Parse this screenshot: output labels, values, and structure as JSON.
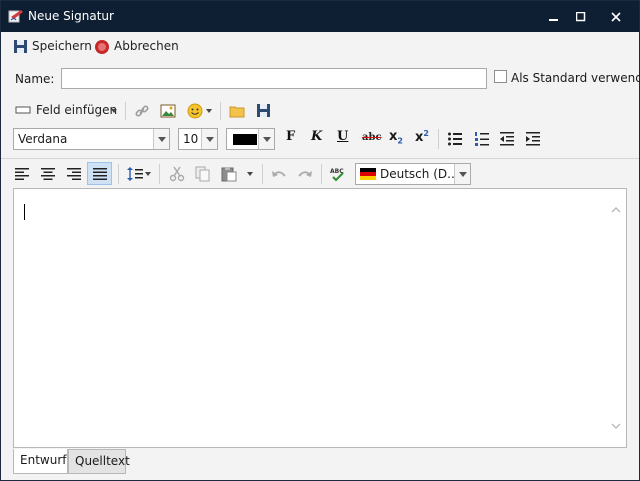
{
  "window": {
    "title": "Neue Signatur"
  },
  "toolbar": {
    "save_label": "Speichern",
    "cancel_label": "Abbrechen"
  },
  "form": {
    "name_label": "Name:",
    "name_value": "",
    "default_checkbox_label": "Als Standard verwenden",
    "default_checked": false
  },
  "insert_toolbar": {
    "insert_field_label": "Feld einfügen"
  },
  "format": {
    "font": "Verdana",
    "size": "10",
    "color": "#000000",
    "bold": "F",
    "italic": "K",
    "underline": "U",
    "strike": "abc",
    "subscript": "x",
    "subscript_mark": "2",
    "superscript": "x",
    "superscript_mark": "2"
  },
  "paragraph": {
    "language": "Deutsch (D..."
  },
  "tabs": [
    {
      "label": "Entwurf"
    },
    {
      "label": "Quelltext"
    }
  ],
  "colors": {
    "titlebar": "#0f1f33",
    "selection": "#cfe1f5",
    "cancel_red": "#c62828"
  }
}
